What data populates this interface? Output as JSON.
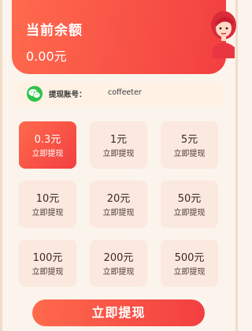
{
  "balance": {
    "label": "当前余额",
    "value": "0.00元"
  },
  "account": {
    "label": "提现账号：",
    "name": "coffeeter",
    "icon": "wechat-icon"
  },
  "amounts": [
    {
      "amount": "0.3元",
      "action": "立即提现",
      "selected": true
    },
    {
      "amount": "1元",
      "action": "立即提现",
      "selected": false
    },
    {
      "amount": "5元",
      "action": "立即提现",
      "selected": false
    },
    {
      "amount": "10元",
      "action": "立即提现",
      "selected": false
    },
    {
      "amount": "20元",
      "action": "立即提现",
      "selected": false
    },
    {
      "amount": "50元",
      "action": "立即提现",
      "selected": false
    },
    {
      "amount": "100元",
      "action": "立即提现",
      "selected": false
    },
    {
      "amount": "200元",
      "action": "立即提现",
      "selected": false
    },
    {
      "amount": "500元",
      "action": "立即提现",
      "selected": false
    }
  ],
  "withdraw_button": "立即提现",
  "colors": {
    "accent_start": "#ff6a4d",
    "accent_end": "#f23f40",
    "cell_bg": "#fbe8de",
    "wechat_green": "#2fc34c"
  }
}
